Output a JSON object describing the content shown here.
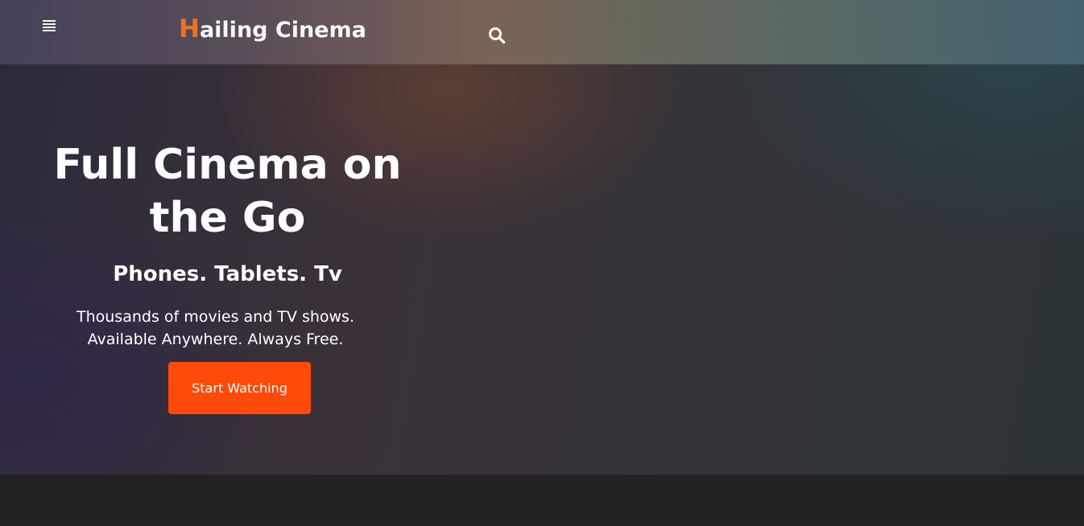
{
  "header": {
    "brand_initial": "H",
    "brand_rest": "ailing Cinema",
    "menu_icon": "hamburger-menu-icon",
    "search_icon": "search-icon"
  },
  "hero": {
    "title_line1": "Full Cinema on",
    "title_line2": "the Go",
    "subtitle": "Phones. Tablets. Tv",
    "desc_line1": "Thousands of movies and TV shows.",
    "desc_line2": "Available Anywhere. Always Free.",
    "cta_label": "Start Watching"
  },
  "colors": {
    "accent": "#ff4a0a",
    "brand_initial": "#f07820",
    "text": "#ffffff",
    "footer_bg": "#222222"
  }
}
